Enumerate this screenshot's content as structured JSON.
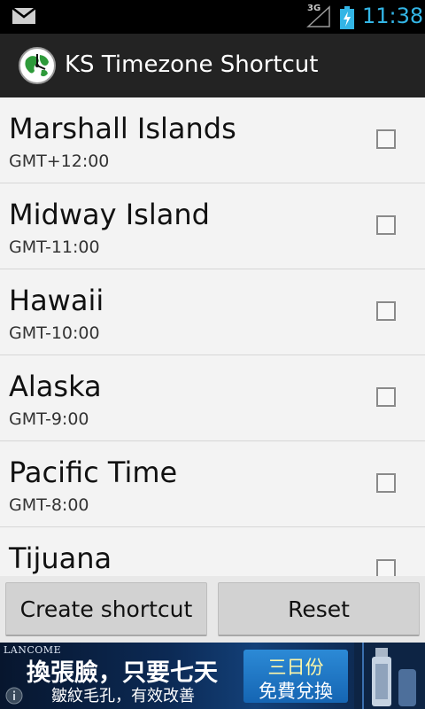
{
  "status_bar": {
    "network": "3G",
    "time": "11:38",
    "icons": [
      "mail-icon",
      "signal-icon",
      "battery-charging-icon"
    ]
  },
  "action_bar": {
    "title": "KS Timezone Shortcut",
    "logo_icon": "globe-clock-icon"
  },
  "timezones": [
    {
      "name": "Marshall Islands",
      "offset": "GMT+12:00",
      "checked": false
    },
    {
      "name": "Midway Island",
      "offset": "GMT-11:00",
      "checked": false
    },
    {
      "name": "Hawaii",
      "offset": "GMT-10:00",
      "checked": false
    },
    {
      "name": "Alaska",
      "offset": "GMT-9:00",
      "checked": false
    },
    {
      "name": "Pacific Time",
      "offset": "GMT-8:00",
      "checked": false
    },
    {
      "name": "Tijuana",
      "offset": "",
      "checked": false
    }
  ],
  "buttons": {
    "create": "Create shortcut",
    "reset": "Reset"
  },
  "ad": {
    "brand": "LANCOME",
    "headline": "換張臉，只要七天",
    "subline": "皺紋毛孔，有效改善",
    "cta_top": "三日份",
    "cta_bottom": "免費兌換",
    "info_icon": "info-icon"
  },
  "colors": {
    "accent": "#33b5e5",
    "action_bar": "#232323",
    "list_bg": "#f3f3f3"
  }
}
